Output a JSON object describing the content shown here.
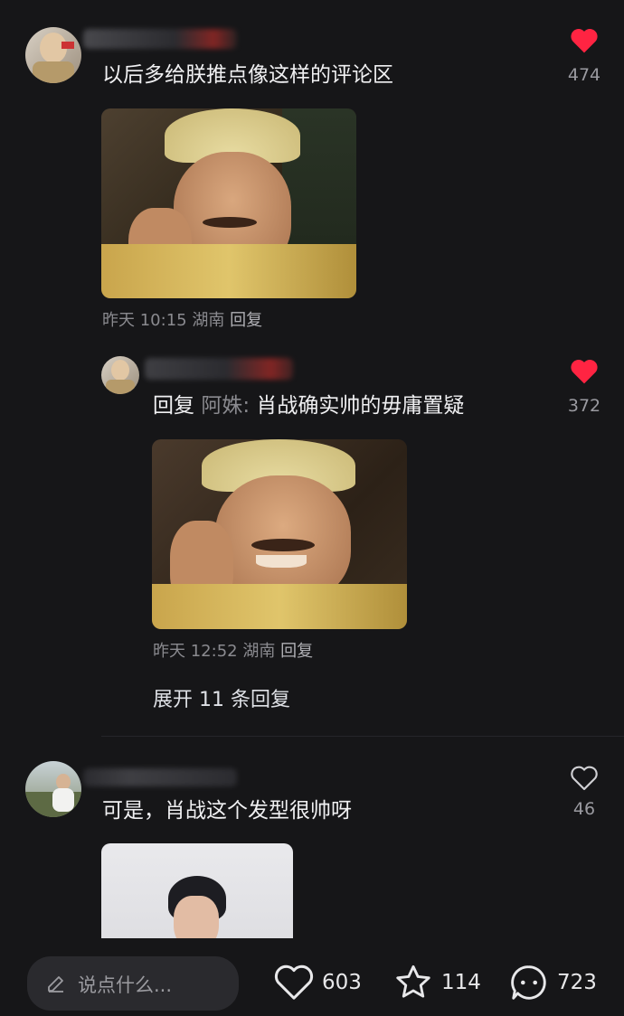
{
  "comments": [
    {
      "text": "以后多给朕推点像这样的评论区",
      "time": "昨天 10:15",
      "location": "湖南",
      "reply_label": "回复",
      "likes": "474",
      "liked": true,
      "image": "qing-emperor-smiling-meme",
      "reply": {
        "prefix": "回复",
        "reply_to": "阿姝:",
        "text": "肖战确实帅的毋庸置疑",
        "time": "昨天 12:52",
        "location": "湖南",
        "reply_label": "回复",
        "likes": "372",
        "liked": true,
        "image": "qing-emperor-laughing-meme"
      },
      "expand_label": "展开 11 条回复"
    },
    {
      "text": "可是，肖战这个发型很帅呀",
      "likes": "46",
      "liked": false,
      "image": "young-man-portrait"
    }
  ],
  "bottom_bar": {
    "input_placeholder": "说点什么...",
    "likes": "603",
    "favorites": "114",
    "comments": "723"
  },
  "colors": {
    "background": "#161618",
    "like_red": "#ff2442",
    "secondary_text": "#8a8a8f"
  },
  "icons": [
    "heart-icon",
    "star-icon",
    "comment-bubble-icon",
    "pencil-icon"
  ]
}
